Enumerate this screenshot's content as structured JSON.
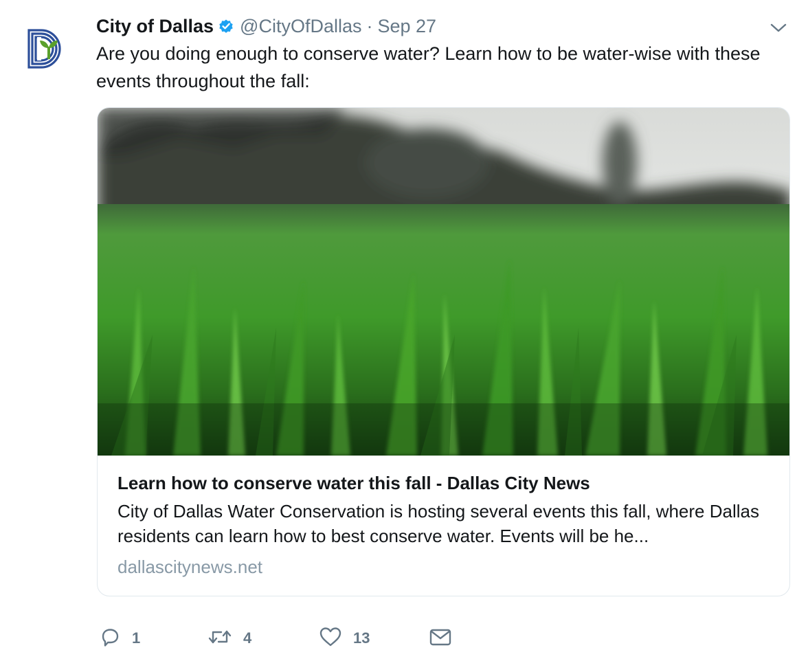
{
  "author": {
    "name": "City of Dallas",
    "handle": "@CityOfDallas",
    "separator": "·",
    "date": "Sep 27",
    "logo_color": "#2d4f9a",
    "leaf_color": "#5aa02c"
  },
  "tweet": {
    "text": "Are you doing enough to conserve water? Learn how to be water-wise with these events throughout the fall:"
  },
  "card": {
    "image_description": "close-up-green-grass-photo",
    "title": "Learn how to conserve water this fall - Dallas City News",
    "description": "City of Dallas Water Conservation is hosting several events this fall, where Dallas residents can learn how to best conserve water. Events will be he...",
    "domain": "dallascitynews.net"
  },
  "actions": {
    "reply_count": "1",
    "retweet_count": "4",
    "like_count": "13"
  },
  "colors": {
    "text": "#14171a",
    "secondary": "#657786",
    "verified": "#1da1f2",
    "border": "#e1e8ed"
  },
  "icons": [
    "verified-badge-icon",
    "caret-down-icon",
    "reply-icon",
    "retweet-icon",
    "like-icon",
    "dm-icon"
  ]
}
